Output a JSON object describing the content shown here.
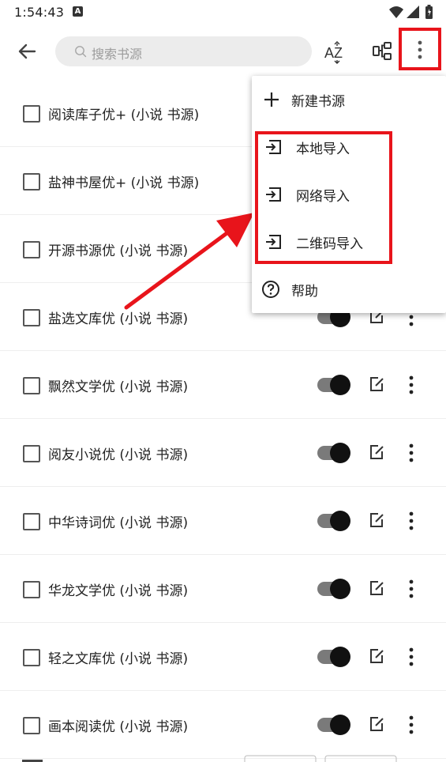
{
  "status_bar": {
    "time": "1:54:43",
    "notification_badge": "A"
  },
  "toolbar": {
    "search_placeholder": "搜索书源",
    "sort_label": "AZ"
  },
  "menu": {
    "items": [
      {
        "label": "新建书源",
        "icon": "plus-icon"
      },
      {
        "label": "本地导入",
        "icon": "import-icon"
      },
      {
        "label": "网络导入",
        "icon": "import-icon"
      },
      {
        "label": "二维码导入",
        "icon": "import-icon"
      },
      {
        "label": "帮助",
        "icon": "help-icon"
      }
    ]
  },
  "sources": [
    {
      "name": "阅读库子优+ (小说 书源)",
      "enabled": true
    },
    {
      "name": "盐神书屋优+ (小说 书源)",
      "enabled": true
    },
    {
      "name": "开源书源优 (小说 书源)",
      "enabled": true
    },
    {
      "name": "盐选文库优 (小说 书源)",
      "enabled": true
    },
    {
      "name": "飘然文学优 (小说 书源)",
      "enabled": true
    },
    {
      "name": "阅友小说优 (小说 书源)",
      "enabled": true
    },
    {
      "name": "中华诗词优 (小说 书源)",
      "enabled": true
    },
    {
      "name": "华龙文学优 (小说 书源)",
      "enabled": true
    },
    {
      "name": "轻之文库优 (小说 书源)",
      "enabled": true
    },
    {
      "name": "画本阅读优 (小说 书源)",
      "enabled": true
    }
  ],
  "colors": {
    "highlight": "#e8141b",
    "switch_thumb": "#111111",
    "switch_track": "#7a7a7a"
  }
}
